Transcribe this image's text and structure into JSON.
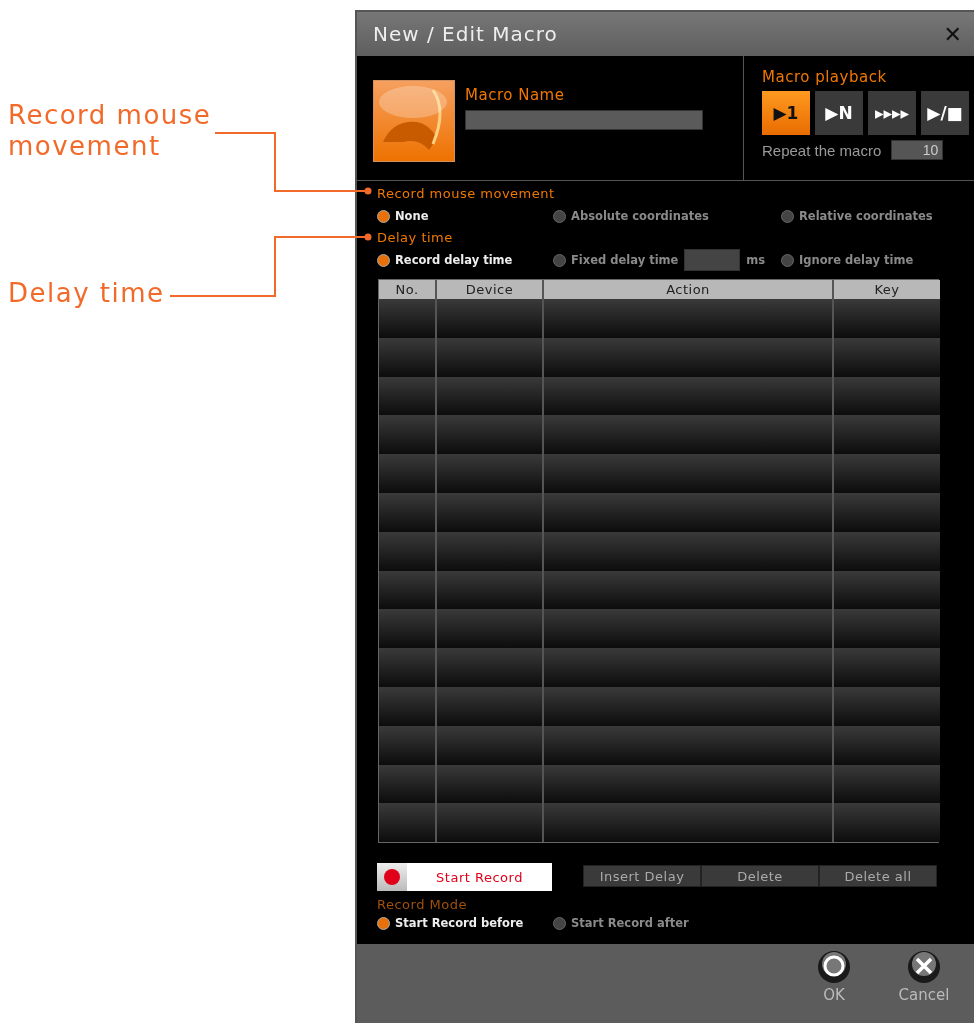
{
  "annotations": [
    {
      "text": "Record mouse movement"
    },
    {
      "text": "Delay time"
    }
  ],
  "window": {
    "title": "New / Edit Macro",
    "close": "✕"
  },
  "macro_name": {
    "label": "Macro Name"
  },
  "playback": {
    "label": "Macro playback",
    "buttons": [
      {
        "glyph": "▶1",
        "selected": true
      },
      {
        "glyph": "▶N",
        "selected": false
      },
      {
        "glyph": "▸▸▸▸",
        "selected": false
      },
      {
        "glyph": "▶/■",
        "selected": false
      }
    ],
    "repeat_label": "Repeat the macro",
    "repeat_value": "10"
  },
  "mouse_movement": {
    "title": "Record mouse movement",
    "options": [
      {
        "label": "None",
        "selected": true
      },
      {
        "label": "Absolute coordinates",
        "selected": false
      },
      {
        "label": "Relative coordinates",
        "selected": false
      }
    ]
  },
  "delay_time": {
    "title": "Delay time",
    "options": [
      {
        "label": "Record delay time",
        "selected": true
      },
      {
        "label": "Fixed delay time",
        "selected": false,
        "unit": "ms"
      },
      {
        "label": "Ignore delay time",
        "selected": false
      }
    ]
  },
  "table": {
    "columns": [
      "No.",
      "Device",
      "Action",
      "Key"
    ]
  },
  "record": {
    "button": "Start Record",
    "actions": [
      "Insert Delay",
      "Delete",
      "Delete all"
    ],
    "mode_label": "Record Mode",
    "mode_options": [
      {
        "label": "Start Record before",
        "selected": true
      },
      {
        "label": "Start Record after",
        "selected": false
      }
    ]
  },
  "footer": {
    "buttons": [
      {
        "label": "OK",
        "kind": "ok"
      },
      {
        "label": "Cancel",
        "kind": "cancel"
      }
    ]
  }
}
